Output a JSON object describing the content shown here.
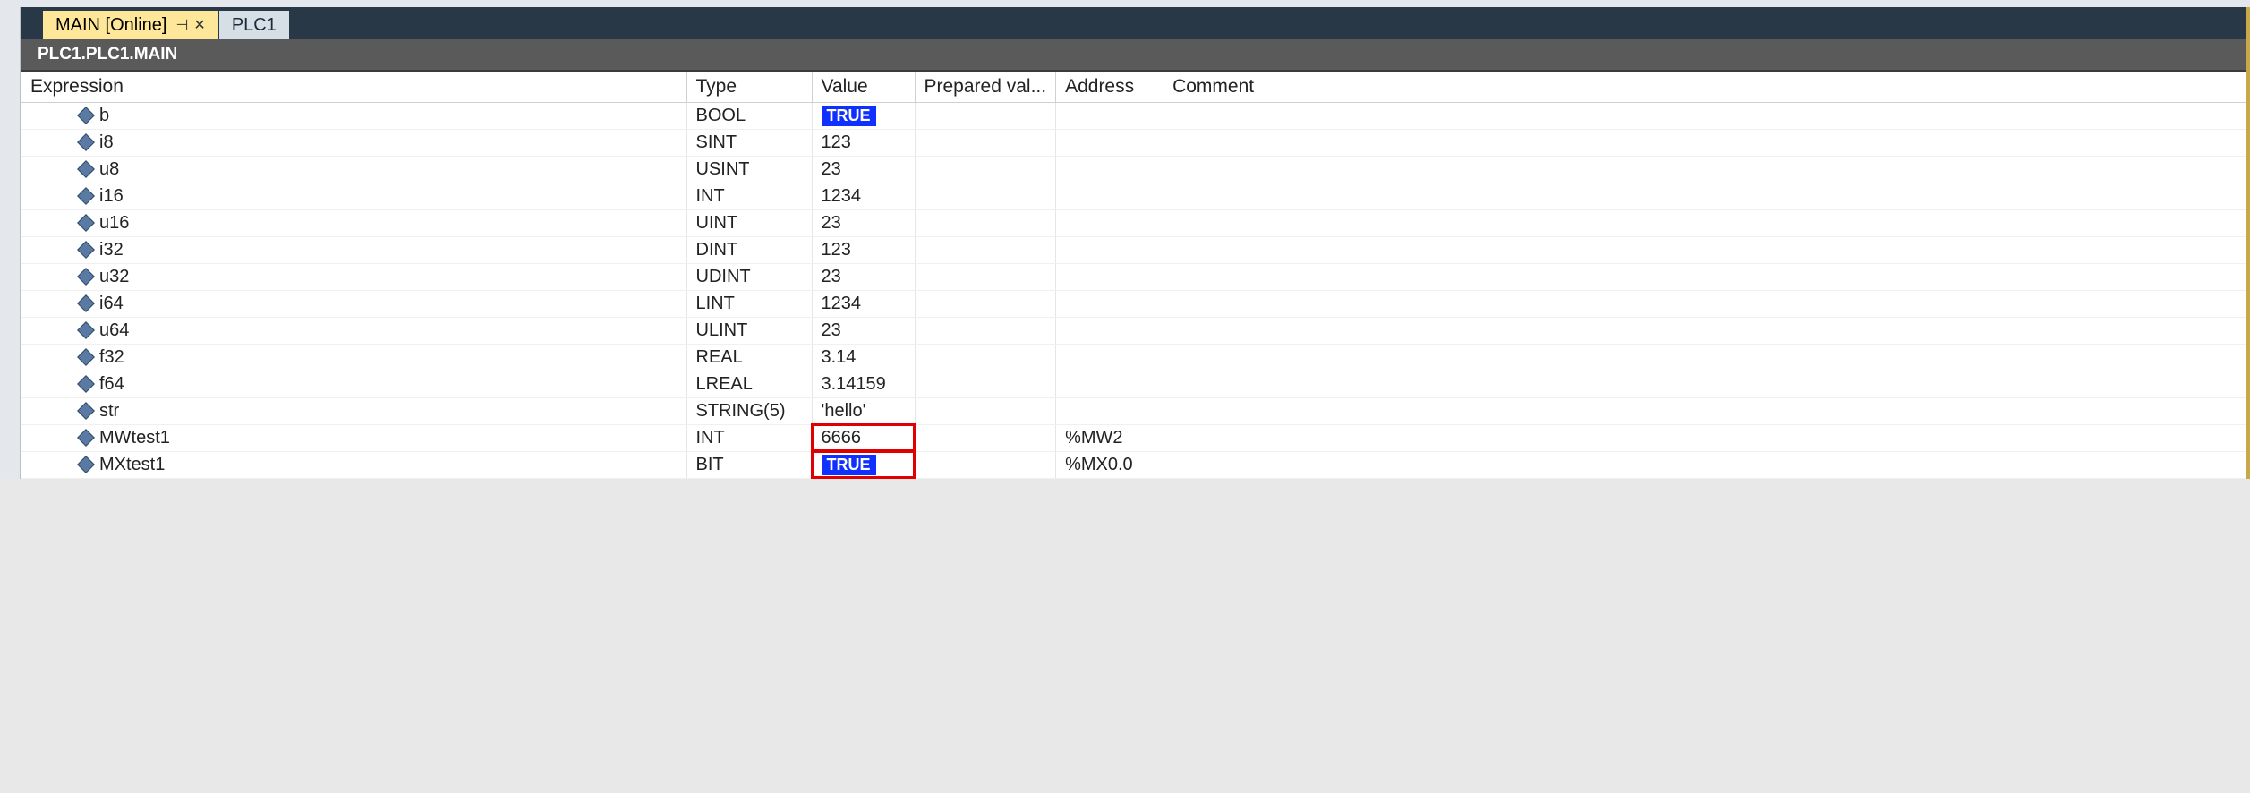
{
  "tabs": [
    {
      "label": "MAIN [Online]",
      "active": true,
      "pinned": true,
      "closable": true
    },
    {
      "label": "PLC1",
      "active": false,
      "pinned": false,
      "closable": false
    }
  ],
  "breadcrumb": "PLC1.PLC1.MAIN",
  "columns": {
    "expression": "Expression",
    "type": "Type",
    "value": "Value",
    "prepared": "Prepared val...",
    "address": "Address",
    "comment": "Comment"
  },
  "rows": [
    {
      "name": "b",
      "type": "BOOL",
      "value": "TRUE",
      "bool": true,
      "prepared": "",
      "address": "",
      "comment": "",
      "highlight": false
    },
    {
      "name": "i8",
      "type": "SINT",
      "value": "123",
      "bool": false,
      "prepared": "",
      "address": "",
      "comment": "",
      "highlight": false
    },
    {
      "name": "u8",
      "type": "USINT",
      "value": "23",
      "bool": false,
      "prepared": "",
      "address": "",
      "comment": "",
      "highlight": false
    },
    {
      "name": "i16",
      "type": "INT",
      "value": "1234",
      "bool": false,
      "prepared": "",
      "address": "",
      "comment": "",
      "highlight": false
    },
    {
      "name": "u16",
      "type": "UINT",
      "value": "23",
      "bool": false,
      "prepared": "",
      "address": "",
      "comment": "",
      "highlight": false
    },
    {
      "name": "i32",
      "type": "DINT",
      "value": "123",
      "bool": false,
      "prepared": "",
      "address": "",
      "comment": "",
      "highlight": false
    },
    {
      "name": "u32",
      "type": "UDINT",
      "value": "23",
      "bool": false,
      "prepared": "",
      "address": "",
      "comment": "",
      "highlight": false
    },
    {
      "name": "i64",
      "type": "LINT",
      "value": "1234",
      "bool": false,
      "prepared": "",
      "address": "",
      "comment": "",
      "highlight": false
    },
    {
      "name": "u64",
      "type": "ULINT",
      "value": "23",
      "bool": false,
      "prepared": "",
      "address": "",
      "comment": "",
      "highlight": false
    },
    {
      "name": "f32",
      "type": "REAL",
      "value": "3.14",
      "bool": false,
      "prepared": "",
      "address": "",
      "comment": "",
      "highlight": false
    },
    {
      "name": "f64",
      "type": "LREAL",
      "value": "3.14159",
      "bool": false,
      "prepared": "",
      "address": "",
      "comment": "",
      "highlight": false
    },
    {
      "name": "str",
      "type": "STRING(5)",
      "value": "'hello'",
      "bool": false,
      "prepared": "",
      "address": "",
      "comment": "",
      "highlight": false
    },
    {
      "name": "MWtest1",
      "type": "INT",
      "value": "6666",
      "bool": false,
      "prepared": "",
      "address": "%MW2",
      "comment": "",
      "highlight": true
    },
    {
      "name": "MXtest1",
      "type": "BIT",
      "value": "TRUE",
      "bool": true,
      "prepared": "",
      "address": "%MX0.0",
      "comment": "",
      "highlight": true
    }
  ]
}
